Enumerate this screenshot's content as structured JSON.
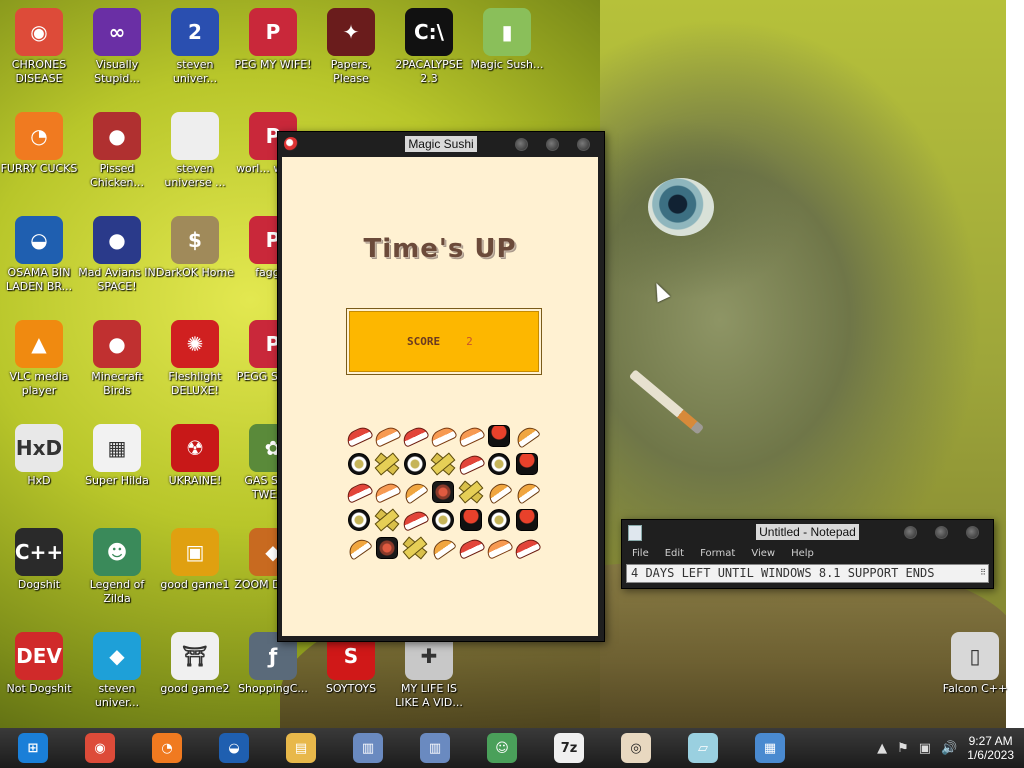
{
  "desktop": {
    "icons": [
      {
        "label": "CHRONES DISEASE",
        "icon": "chrome-icon",
        "color": "#dd4b39",
        "glyph": "◉"
      },
      {
        "label": "Visually Stupid...",
        "icon": "visual-studio-icon",
        "color": "#6a2fa5",
        "glyph": "∞"
      },
      {
        "label": "steven univer...",
        "icon": "game-icon",
        "color": "#2a4fb0",
        "glyph": "2"
      },
      {
        "label": "PEG MY WIFE!",
        "icon": "peggle-icon",
        "color": "#c9283a",
        "glyph": "P"
      },
      {
        "label": "Papers, Please",
        "icon": "papers-please-icon",
        "color": "#6a1c1c",
        "glyph": "✦"
      },
      {
        "label": "2PACALYPSE 2.3",
        "icon": "console-icon",
        "color": "#111111",
        "glyph": "C:\\"
      },
      {
        "label": "Magic Sush...",
        "icon": "archive-icon",
        "color": "#8abf5a",
        "glyph": "▮"
      },
      {
        "label": "FURRY CUCKS",
        "icon": "firefox-icon",
        "color": "#f07a20",
        "glyph": "◔"
      },
      {
        "label": "Pissed Chicken...",
        "icon": "angry-birds-icon",
        "color": "#b03030",
        "glyph": "●"
      },
      {
        "label": "steven universe ...",
        "icon": "file-icon",
        "color": "#eeeeee",
        "glyph": ""
      },
      {
        "label": "worl... warc...",
        "icon": "peggle-icon",
        "color": "#c9283a",
        "glyph": "P"
      },
      {
        "label": "OSAMA BIN LADEN BR...",
        "icon": "obama-icon",
        "color": "#1f5fb0",
        "glyph": "◒"
      },
      {
        "label": "Mad Avians IN SPACE!",
        "icon": "angry-birds-space-icon",
        "color": "#2a3a8a",
        "glyph": "●"
      },
      {
        "label": "DarkOK Home",
        "icon": "money-bag-icon",
        "color": "#a08a5a",
        "glyph": "$"
      },
      {
        "label": "faggot",
        "icon": "peggle-icon",
        "color": "#c9283a",
        "glyph": "P"
      },
      {
        "label": "VLC media player",
        "icon": "vlc-icon",
        "color": "#f08a10",
        "glyph": "▲"
      },
      {
        "label": "Minecraft Birds",
        "icon": "angry-birds-icon",
        "color": "#c03030",
        "glyph": "●"
      },
      {
        "label": "Fleshlight DELUXE!",
        "icon": "red-creature-icon",
        "color": "#d02020",
        "glyph": "✺"
      },
      {
        "label": "PEGG STEA...",
        "icon": "peggle-icon",
        "color": "#c9283a",
        "glyph": "P"
      },
      {
        "label": "HxD",
        "icon": "hxd-icon",
        "color": "#e8e8e8",
        "glyph": "HxD"
      },
      {
        "label": "Super Hilda",
        "icon": "pixel-dog-icon",
        "color": "#f2f2f2",
        "glyph": "▦"
      },
      {
        "label": "UKRAINE!",
        "icon": "radiation-icon",
        "color": "#c81818",
        "glyph": "☢"
      },
      {
        "label": "GAS STA... TWEA...",
        "icon": "flower-icon",
        "color": "#5a8a3a",
        "glyph": "✿"
      },
      {
        "label": "Dogshit",
        "icon": "dev-cpp-icon",
        "color": "#2a2a2a",
        "glyph": "C++"
      },
      {
        "label": "Legend of Zilda",
        "icon": "zelda-icon",
        "color": "#3a8a5a",
        "glyph": "☻"
      },
      {
        "label": "good game1",
        "icon": "mahjong-icon",
        "color": "#e0a010",
        "glyph": "▣"
      },
      {
        "label": "ZOOM DELU...",
        "icon": "zuma-icon",
        "color": "#c86a20",
        "glyph": "◆"
      },
      {
        "label": "Not Dogshit",
        "icon": "dev-cpp-red-icon",
        "color": "#d02a2a",
        "glyph": "DEV"
      },
      {
        "label": "steven univer...",
        "icon": "diamond-icon",
        "color": "#1ea0d8",
        "glyph": "◆"
      },
      {
        "label": "good game2",
        "icon": "torii-icon",
        "color": "#f0f0f0",
        "glyph": "⛩"
      },
      {
        "label": "ShoppingC...",
        "icon": "flash-icon",
        "color": "#5a6a7a",
        "glyph": "ƒ"
      },
      {
        "label": "SOYTOYS",
        "icon": "s-logo-icon",
        "color": "#d01818",
        "glyph": "S"
      },
      {
        "label": "MY LIFE IS LIKE A VID...",
        "icon": "gamepad-icon",
        "color": "#c8c8c8",
        "glyph": "✚"
      },
      {
        "label": "Falcon C++",
        "icon": "recycle-bin-icon",
        "color": "#d8d8d8",
        "glyph": "▯"
      }
    ]
  },
  "magic_sushi": {
    "title": "Magic Sushi",
    "headline": "Time's UP",
    "score_label": "SCORE",
    "score_value": "2",
    "grid": [
      [
        "tuna",
        "shrimp",
        "tuna",
        "shrimp",
        "shrimp",
        "roe",
        "tamago"
      ],
      [
        "roll",
        "cucumber",
        "roll",
        "cucumber",
        "tuna",
        "roll",
        "roe"
      ],
      [
        "tuna",
        "shrimp",
        "tamago",
        "maki",
        "cucumber",
        "tamago",
        "tamago"
      ],
      [
        "roll",
        "cucumber",
        "tuna",
        "roll",
        "roe",
        "roll",
        "roe"
      ],
      [
        "tamago",
        "maki",
        "cucumber",
        "tamago",
        "tuna",
        "shrimp",
        "tuna"
      ]
    ]
  },
  "notepad": {
    "title": "Untitled - Notepad",
    "menu": [
      "File",
      "Edit",
      "Format",
      "View",
      "Help"
    ],
    "content": "4 DAYS LEFT UNTIL WINDOWS 8.1 SUPPORT ENDS"
  },
  "taskbar": {
    "items": [
      {
        "icon": "start-orb-icon",
        "color": "#1a7fd8",
        "glyph": "⊞"
      },
      {
        "icon": "chrome-icon",
        "color": "#dd4b39",
        "glyph": "◉"
      },
      {
        "icon": "firefox-icon",
        "color": "#f07a20",
        "glyph": "◔"
      },
      {
        "icon": "obama-icon",
        "color": "#1f5fb0",
        "glyph": "◒"
      },
      {
        "icon": "file-explorer-icon",
        "color": "#e8b84a",
        "glyph": "▤"
      },
      {
        "icon": "installer-icon",
        "color": "#6a8ac0",
        "glyph": "▥"
      },
      {
        "icon": "installer-icon-2",
        "color": "#6a8ac0",
        "glyph": "▥"
      },
      {
        "icon": "people-icon",
        "color": "#4aa05a",
        "glyph": "☺"
      },
      {
        "icon": "7zip-icon",
        "color": "#f0f0f0",
        "glyph": "7z"
      },
      {
        "icon": "sushi-icon",
        "color": "#e8d8c0",
        "glyph": "◎"
      },
      {
        "icon": "notepad-icon",
        "color": "#9ad0e0",
        "glyph": "▱"
      },
      {
        "icon": "image-viewer-icon",
        "color": "#4a8ad0",
        "glyph": "▦"
      }
    ],
    "time": "9:27 AM",
    "date": "1/6/2023"
  }
}
